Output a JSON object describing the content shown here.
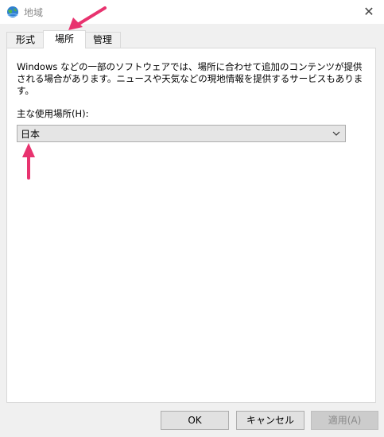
{
  "window": {
    "title": "地域",
    "icon": "globe-icon",
    "close_icon": "close-icon"
  },
  "tabs": [
    {
      "label": "形式",
      "active": false
    },
    {
      "label": "場所",
      "active": true
    },
    {
      "label": "管理",
      "active": false
    }
  ],
  "location": {
    "description": "Windows などの一部のソフトウェアでは、場所に合わせて追加のコンテンツが提供される場合があります。ニュースや天気などの現地情報を提供するサービスもあります。",
    "label": "主な使用場所(H):",
    "selected": "日本",
    "dropdown_icon": "chevron-down-icon"
  },
  "buttons": {
    "ok": "OK",
    "cancel": "キャンセル",
    "apply": "適用(A)"
  },
  "colors": {
    "annotation_arrow": "#e8336f"
  }
}
